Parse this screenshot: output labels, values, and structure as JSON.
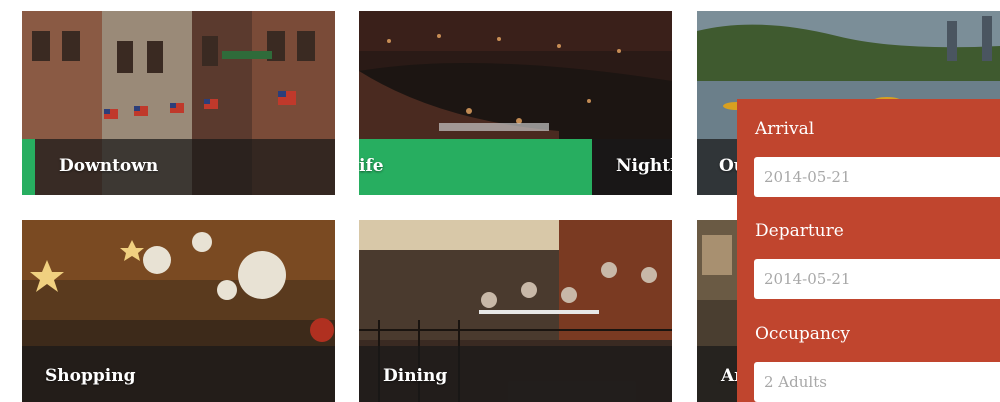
{
  "tiles": {
    "downtown": {
      "label": "Downtown"
    },
    "nightlife": {
      "label_left": "ife",
      "label_right": "Nightli"
    },
    "outdoors": {
      "label": "Ou"
    },
    "shopping": {
      "label": "Shopping"
    },
    "dining": {
      "label": "Dining"
    },
    "arts": {
      "label": "Ar"
    }
  },
  "booking": {
    "arrival_label": "Arrival",
    "arrival_value": "2014-05-21",
    "departure_label": "Departure",
    "departure_value": "2014-05-21",
    "occupancy_label": "Occupancy",
    "occupancy_value": "2 Adults"
  },
  "colors": {
    "accent_green": "#27ae60",
    "panel_red": "#c0452e"
  }
}
